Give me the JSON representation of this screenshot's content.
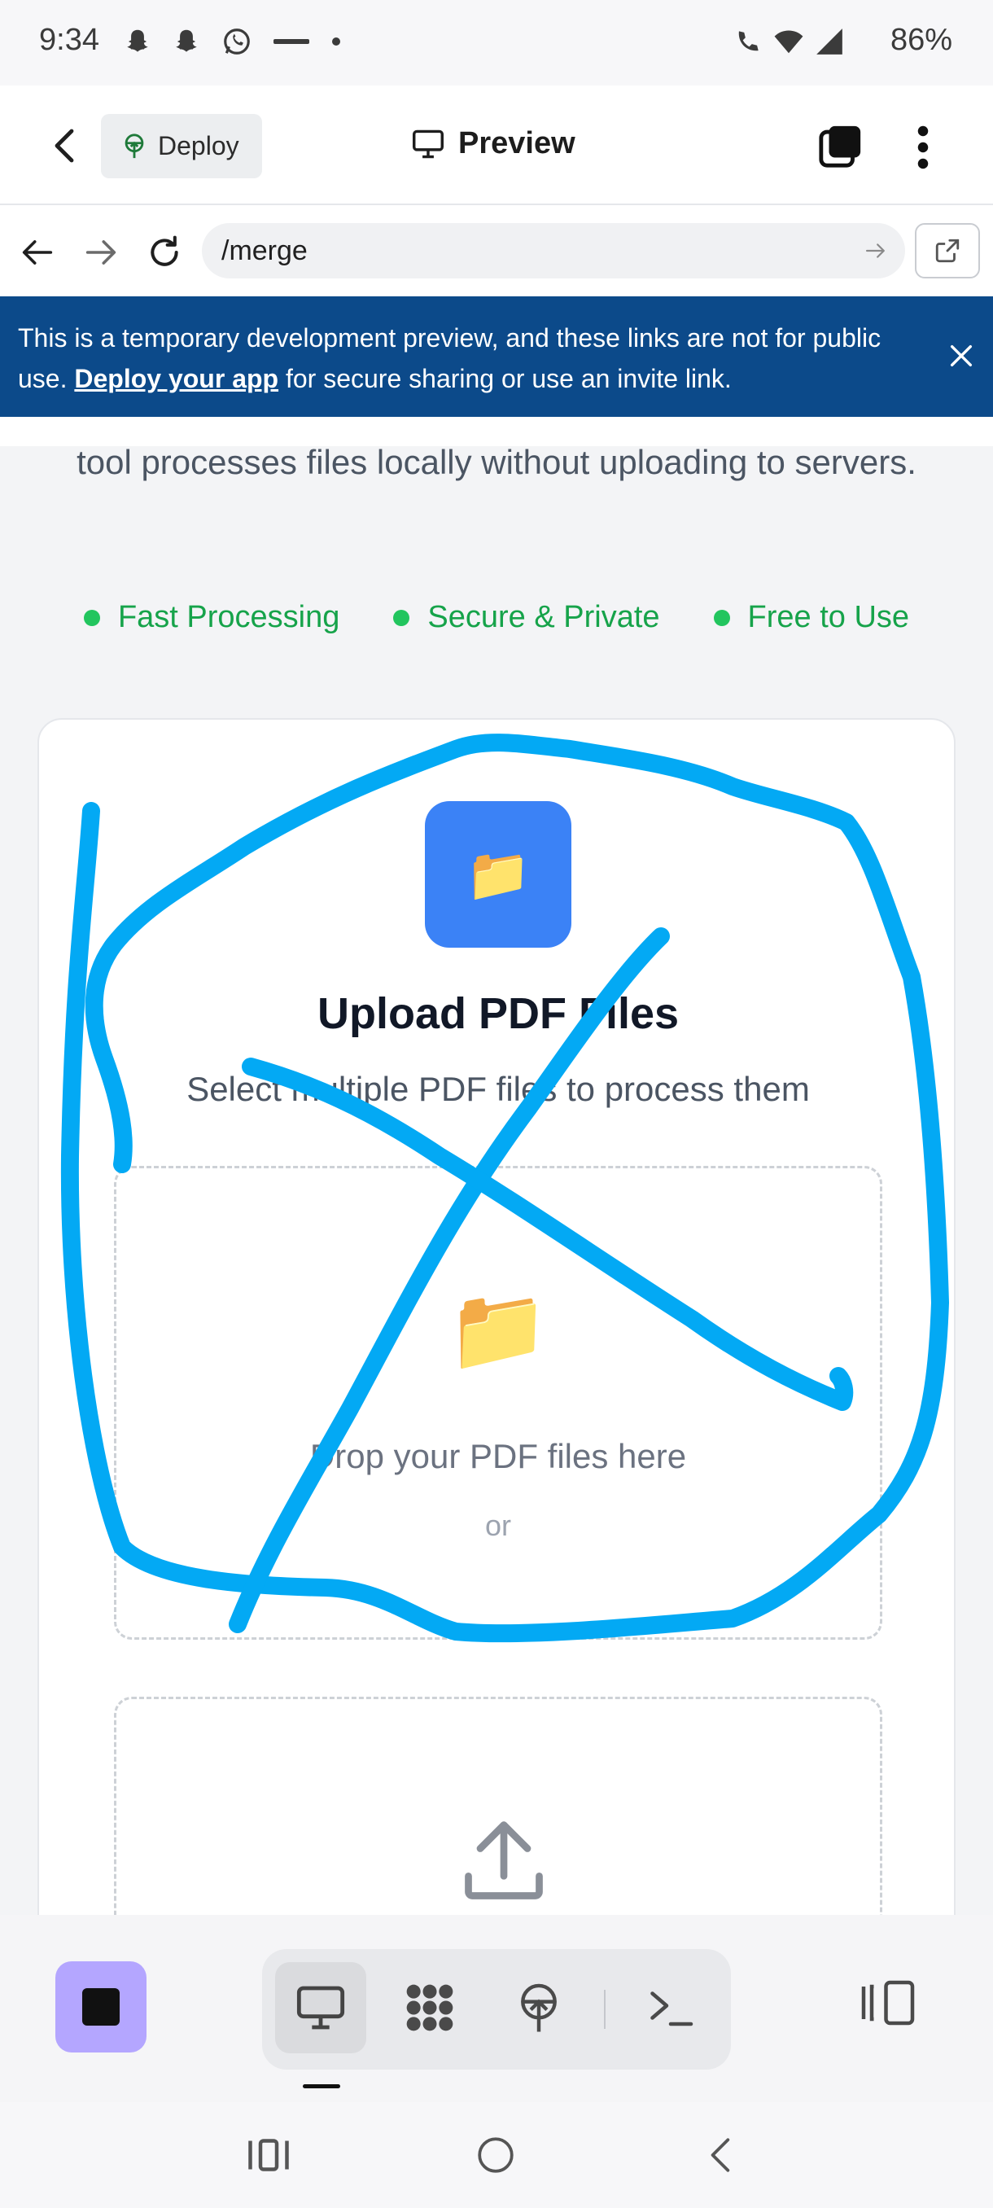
{
  "status_bar": {
    "time": "9:34",
    "battery": "86%"
  },
  "header": {
    "deploy_label": "Deploy",
    "title": "Preview"
  },
  "url_bar": {
    "path": "/merge"
  },
  "banner": {
    "text_before": "This is a temporary development preview, and these links are not for public use. ",
    "link": "Deploy your app",
    "text_after": " for secure sharing or use an invite link."
  },
  "page": {
    "intro": "tool processes files locally without uploading to servers.",
    "features": [
      "Fast Processing",
      "Secure & Private",
      "Free to Use"
    ],
    "card": {
      "title": "Upload PDF Files",
      "subtitle": "Select multiple PDF files to process them",
      "drop_text": "Drop your PDF files here",
      "or": "or"
    }
  },
  "colors": {
    "banner": "#0c4a8a",
    "accent_green": "#22c55e",
    "folder_badge": "#3b82f6",
    "scribble": "#03a9f4",
    "run_button": "#b4a6ff"
  },
  "icons": {
    "toolbar_tabs": [
      "monitor-icon",
      "apps-grid-icon",
      "deploy-icon",
      "terminal-icon"
    ],
    "nav": [
      "recents-icon",
      "home-icon",
      "back-icon"
    ]
  }
}
